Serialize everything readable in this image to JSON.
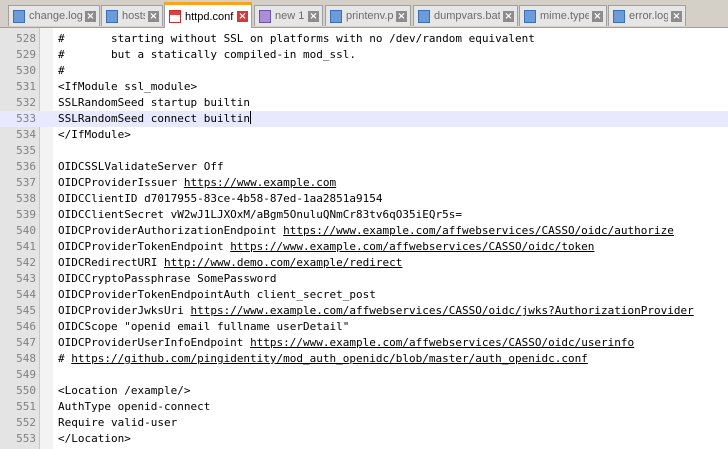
{
  "tabs": [
    {
      "label": "change.log",
      "icon": "blue-file-icon",
      "active": false
    },
    {
      "label": "hosts",
      "icon": "blue-file-icon",
      "active": false
    },
    {
      "label": "httpd.conf",
      "icon": "red-file-icon",
      "active": true
    },
    {
      "label": "new 1",
      "icon": "purple-file-icon",
      "active": false
    },
    {
      "label": "printenv.pl",
      "icon": "blue-file-icon",
      "active": false
    },
    {
      "label": "dumpvars.bat",
      "icon": "blue-file-icon",
      "active": false
    },
    {
      "label": "mime.types",
      "icon": "blue-file-icon",
      "active": false
    },
    {
      "label": "error.log",
      "icon": "blue-file-icon",
      "active": false
    }
  ],
  "close_glyph": "×",
  "lines": [
    {
      "num": "528",
      "text": "#       starting without SSL on platforms with no /dev/random equivalent"
    },
    {
      "num": "529",
      "text": "#       but a statically compiled-in mod_ssl."
    },
    {
      "num": "530",
      "text": "#"
    },
    {
      "num": "531",
      "text": "<IfModule ssl_module>"
    },
    {
      "num": "532",
      "text": "SSLRandomSeed startup builtin"
    },
    {
      "num": "533",
      "text": "SSLRandomSeed connect builtin",
      "current": true
    },
    {
      "num": "534",
      "text": "</IfModule>"
    },
    {
      "num": "535",
      "text": ""
    },
    {
      "num": "536",
      "text": "OIDCSSLValidateServer Off"
    },
    {
      "num": "537",
      "text": "OIDCProviderIssuer ",
      "url": "https://www.example.com"
    },
    {
      "num": "538",
      "text": "OIDCClientID d7017955-83ce-4b58-87ed-1aa2851a9154"
    },
    {
      "num": "539",
      "text": "OIDCClientSecret vW2wJ1LJXOxM/aBgm5OnuluQNmCr83tv6qO35iEQr5s="
    },
    {
      "num": "540",
      "text": "OIDCProviderAuthorizationEndpoint ",
      "url": "https://www.example.com/affwebservices/CASSO/oidc/authorize"
    },
    {
      "num": "541",
      "text": "OIDCProviderTokenEndpoint ",
      "url": "https://www.example.com/affwebservices/CASSO/oidc/token"
    },
    {
      "num": "542",
      "text": "OIDCRedirectURI ",
      "url": "http://www.demo.com/example/redirect"
    },
    {
      "num": "543",
      "text": "OIDCCryptoPassphrase SomePassword"
    },
    {
      "num": "544",
      "text": "OIDCProviderTokenEndpointAuth client_secret_post"
    },
    {
      "num": "545",
      "text": "OIDCProviderJwksUri ",
      "url": "https://www.example.com/affwebservices/CASSO/oidc/jwks?AuthorizationProvider"
    },
    {
      "num": "546",
      "text": "OIDCScope \"openid email fullname userDetail\""
    },
    {
      "num": "547",
      "text": "OIDCProviderUserInfoEndpoint ",
      "url": "https://www.example.com/affwebservices/CASSO/oidc/userinfo"
    },
    {
      "num": "548",
      "text": "# ",
      "url": "https://github.com/pingidentity/mod_auth_openidc/blob/master/auth_openidc.conf"
    },
    {
      "num": "549",
      "text": ""
    },
    {
      "num": "550",
      "text": "<Location /example/>"
    },
    {
      "num": "551",
      "text": "AuthType openid-connect"
    },
    {
      "num": "552",
      "text": "Require valid-user"
    },
    {
      "num": "553",
      "text": "</Location>"
    }
  ]
}
